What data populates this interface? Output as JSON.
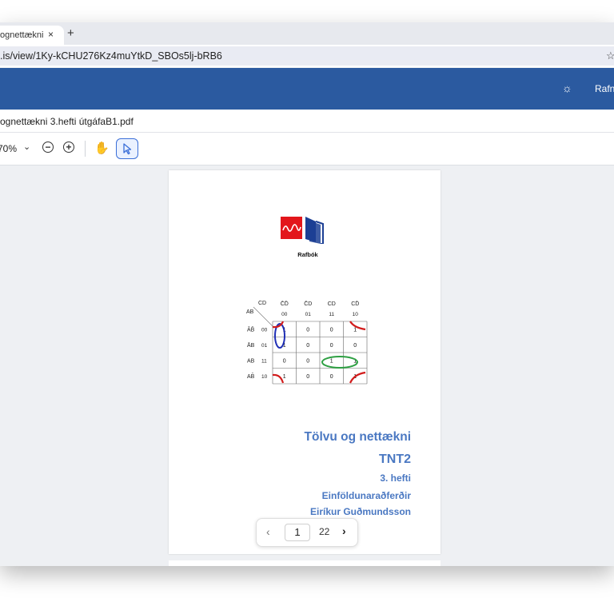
{
  "browser": {
    "tab_title": "ognettækni",
    "tab_close": "×",
    "new_tab": "+",
    "url": ".is/view/1Ky-kCHU276Kz4muYtkD_SBOs5lj-bRB6",
    "bookmark_icon": "star-icon"
  },
  "header": {
    "theme_icon": "sun-icon",
    "text": "Rafn"
  },
  "file": {
    "name": "ognettækni 3.hefti útgáfaB1.pdf"
  },
  "toolbar": {
    "zoom": "70%",
    "zoom_out": "−",
    "zoom_in": "+",
    "hand_tool_icon": "hand-icon",
    "select_tool_icon": "cursor-icon"
  },
  "document": {
    "brand": "Rafbók",
    "logo_colors": [
      "#e3161b",
      "#1c3f94"
    ],
    "kmap": {
      "corner_row_label": "AB",
      "corner_col_label": "CD",
      "col_labels": [
        "C̄D̄",
        "C̄D",
        "CD",
        "CD̄"
      ],
      "col_codes": [
        "00",
        "01",
        "11",
        "10"
      ],
      "row_labels": [
        "ĀB̄",
        "ĀB",
        "AB",
        "AB̄"
      ],
      "row_codes": [
        "00",
        "01",
        "11",
        "10"
      ],
      "cells": [
        [
          "1",
          "0",
          "0",
          "1"
        ],
        [
          "1",
          "0",
          "0",
          "0"
        ],
        [
          "0",
          "0",
          "1",
          "1"
        ],
        [
          "1",
          "0",
          "0",
          "1"
        ]
      ],
      "group_colors": [
        "#1f2fb5",
        "#2ea043",
        "#d21c1c"
      ]
    },
    "title": "Tölvu og nettækni",
    "code": "TNT2",
    "issue": "3. hefti",
    "subject": "Einföldunaraðferðir",
    "author": "Eiríkur Guðmundsson"
  },
  "pager": {
    "prev": "‹",
    "current": "1",
    "total": "22",
    "next": "›"
  }
}
